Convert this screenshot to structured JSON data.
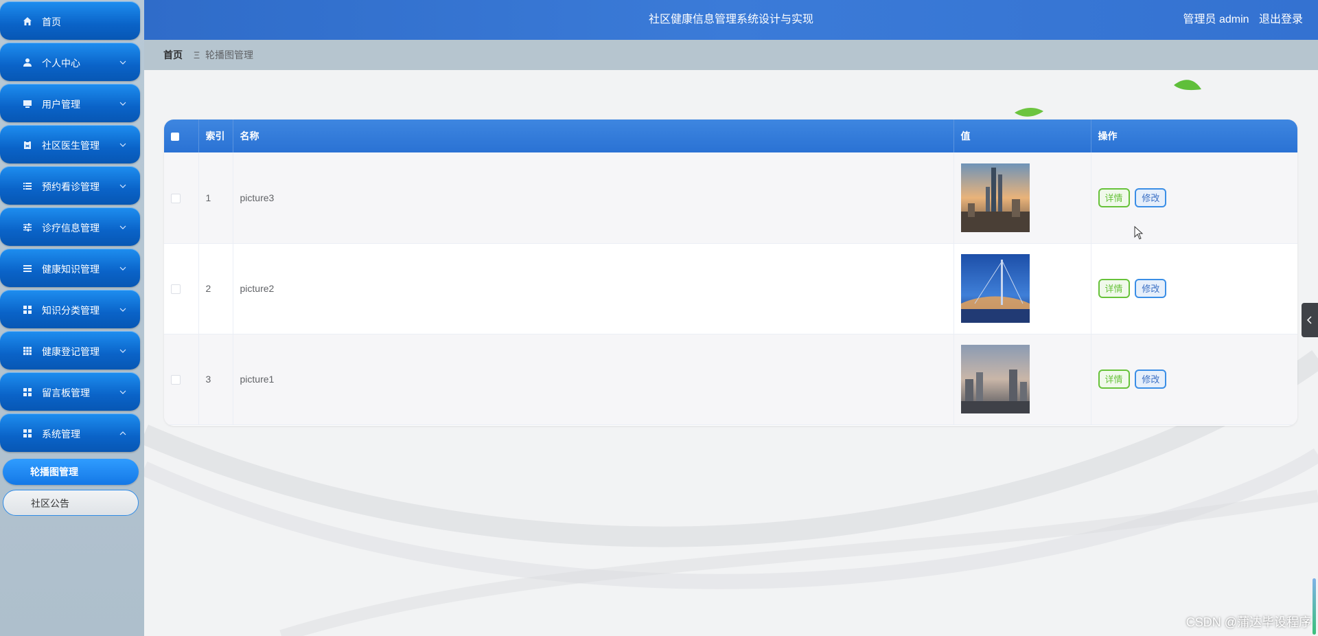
{
  "header": {
    "title": "社区健康信息管理系统设计与实现",
    "user": "管理员 admin",
    "logout": "退出登录"
  },
  "sidebar": {
    "items": [
      {
        "label": "首页",
        "icon": "home-icon"
      },
      {
        "label": "个人中心",
        "icon": "user-icon"
      },
      {
        "label": "用户管理",
        "icon": "monitor-icon"
      },
      {
        "label": "社区医生管理",
        "icon": "clipboard-icon"
      },
      {
        "label": "预约看诊管理",
        "icon": "list-icon"
      },
      {
        "label": "诊疗信息管理",
        "icon": "sliders-icon"
      },
      {
        "label": "健康知识管理",
        "icon": "menu-icon"
      },
      {
        "label": "知识分类管理",
        "icon": "grid-icon"
      },
      {
        "label": "健康登记管理",
        "icon": "table-icon"
      },
      {
        "label": "留言板管理",
        "icon": "grid-icon"
      },
      {
        "label": "系统管理",
        "icon": "grid-icon"
      }
    ],
    "subitems": [
      {
        "label": "轮播图管理",
        "active": true
      },
      {
        "label": "社区公告",
        "active": false
      }
    ]
  },
  "breadcrumb": {
    "home": "首页",
    "separator": "Ξ",
    "current": "轮播图管理"
  },
  "table": {
    "columns": [
      "索引",
      "名称",
      "值",
      "操作"
    ],
    "rows": [
      {
        "index": "1",
        "name": "picture3",
        "image": "city-skyline-sunset"
      },
      {
        "index": "2",
        "name": "picture2",
        "image": "bridge-night-blue"
      },
      {
        "index": "3",
        "name": "picture1",
        "image": "city-skyline-haze"
      }
    ],
    "actions": {
      "detail": "详情",
      "edit": "修改"
    }
  },
  "colors": {
    "header": "#3b7bd8",
    "menu": "#0a63c8",
    "detail": "#67c23a",
    "edit": "#3a8ee6"
  },
  "watermark": "CSDN @蒲达毕设程序"
}
